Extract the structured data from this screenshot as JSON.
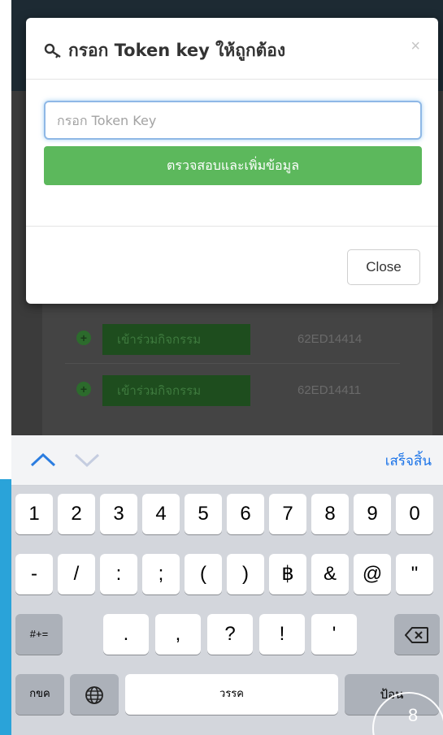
{
  "modal": {
    "title": "กรอก Token key ให้ถูกต้อง",
    "close_symbol": "×",
    "input_placeholder": "กรอก Token Key",
    "verify_button": "ตรวจสอบและเพิ่มข้อมูล",
    "close_button": "Close"
  },
  "background": {
    "rows": [
      {
        "button": "เข้าร่วมกิจกรรม",
        "code": "62ED14414"
      },
      {
        "button": "เข้าร่วมกิจกรรม",
        "code": "62ED14411"
      }
    ]
  },
  "accessory": {
    "done_label": "เสร็จสิ้น"
  },
  "keyboard": {
    "row1": [
      "1",
      "2",
      "3",
      "4",
      "5",
      "6",
      "7",
      "8",
      "9",
      "0"
    ],
    "row2": [
      "-",
      "/",
      ":",
      ";",
      "(",
      ")",
      "฿",
      "&",
      "@",
      "\""
    ],
    "row3_shift": "#+=",
    "row3": [
      ".",
      ",",
      "?",
      "!",
      "'"
    ],
    "lang_key": "กขค",
    "space_label": "วรรค",
    "return_label": "ป้อน",
    "badge": "8"
  },
  "colors": {
    "accent": "#5cb85c",
    "link": "#1a73e8",
    "focus": "#8fb8e6"
  }
}
